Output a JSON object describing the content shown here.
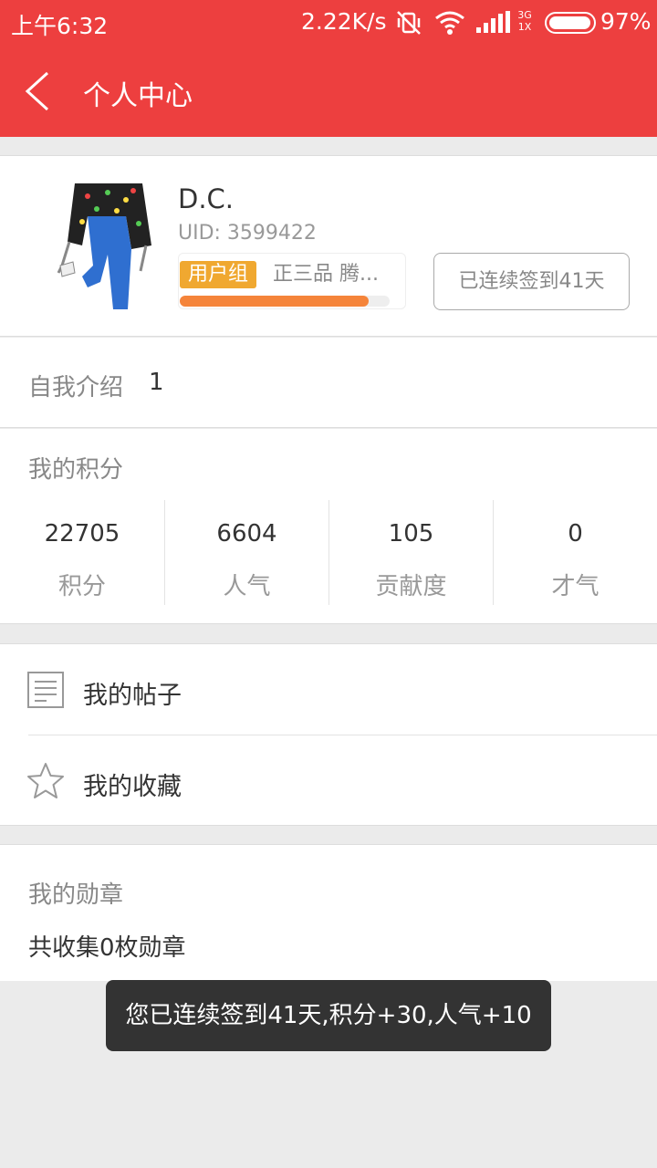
{
  "status_bar": {
    "time": "上午6:32",
    "speed": "2.22K/s",
    "network_top": "3G",
    "network_bottom": "1X",
    "battery": "97%",
    "battery_level": 0.97
  },
  "header": {
    "title": "个人中心",
    "back_icon": "chevron-left-icon"
  },
  "profile": {
    "name": "D.C.",
    "uid": "UID: 3599422",
    "group_tag": "用户组",
    "group_name": "正三品  腾...",
    "group_progress": 0.9,
    "signin_label": "已连续签到41天"
  },
  "intro": {
    "label": "自我介绍",
    "value": "1"
  },
  "points": {
    "title": "我的积分",
    "stats": [
      {
        "value": "22705",
        "label": "积分"
      },
      {
        "value": "6604",
        "label": "人气"
      },
      {
        "value": "105",
        "label": "贡献度"
      },
      {
        "value": "0",
        "label": "才气"
      }
    ]
  },
  "menu": {
    "items": [
      {
        "label": "我的帖子",
        "icon": "document-icon"
      },
      {
        "label": "我的收藏",
        "icon": "star-icon"
      }
    ]
  },
  "medals": {
    "title": "我的勋章",
    "count": "共收集0枚勋章"
  },
  "toast": {
    "message": "您已连续签到41天,积分+30,人气+10"
  },
  "colors": {
    "primary": "#ed3f3f",
    "group_tag": "#f0a830",
    "progress": "#f5843a",
    "toast_bg": "#333333"
  }
}
